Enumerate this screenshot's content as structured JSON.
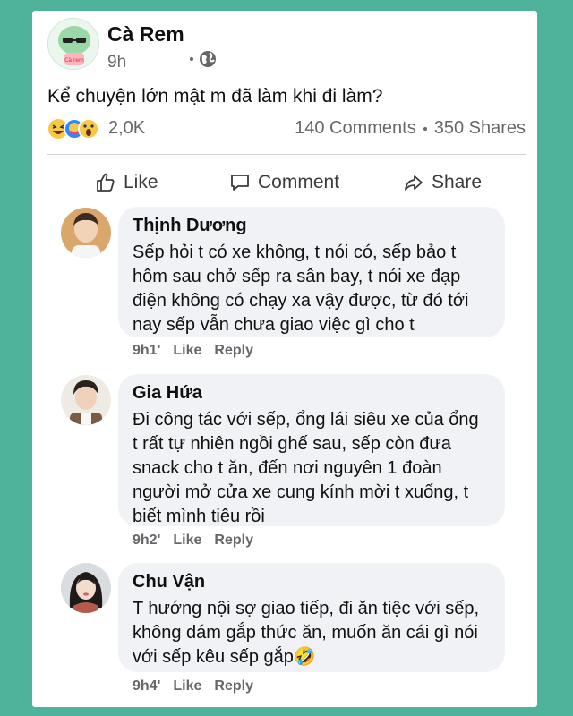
{
  "post": {
    "author": "Cà Rem",
    "avatar_label": "Cà rem",
    "time": "9h",
    "privacy_icon": "globe-icon",
    "text": "Kể chuyện lớn mật m đã làm khi đi làm?",
    "reactions_icons": [
      "laugh-react-icon",
      "care-react-icon",
      "wow-react-icon"
    ],
    "reaction_count": "2,0K",
    "comments_count": "140 Comments",
    "shares_count": "350 Shares"
  },
  "actions": {
    "like": "Like",
    "comment": "Comment",
    "share": "Share"
  },
  "comments": [
    {
      "name": "Thịnh Dương",
      "lines": [
        "Sếp hỏi t có xe không, t nói có, sếp bảo t",
        "hôm sau chở sếp ra sân bay, t nói xe đạp",
        "điện không có chạy xa vậy được, từ đó tới",
        "nay sếp vẫn chưa giao việc gì cho t"
      ],
      "time": "9h1'",
      "like": "Like",
      "reply": "Reply"
    },
    {
      "name": "Gia Hứa",
      "lines": [
        "Đi công tác với sếp, ổng lái siêu xe của ổng",
        "t rất tự nhiên ngồi ghế sau, sếp còn đưa",
        "snack cho t ăn, đến nơi nguyên 1 đoàn",
        "người mở cửa xe cung kính mời t xuống, t",
        "biết mình tiêu rồi"
      ],
      "time": "9h2'",
      "like": "Like",
      "reply": "Reply"
    },
    {
      "name": "Chu Vận",
      "lines": [
        "T hướng nội sợ giao tiếp, đi ăn tiệc với sếp,",
        "không dám gắp thức ăn, muốn ăn cái gì nói",
        "với sếp kêu sếp gắp🤣"
      ],
      "time": "9h4'",
      "like": "Like",
      "reply": "Reply"
    }
  ],
  "colors": {
    "background": "#4fb39b",
    "card": "#ffffff",
    "bubble": "#f0f2f5",
    "muted_text": "#65676b"
  }
}
